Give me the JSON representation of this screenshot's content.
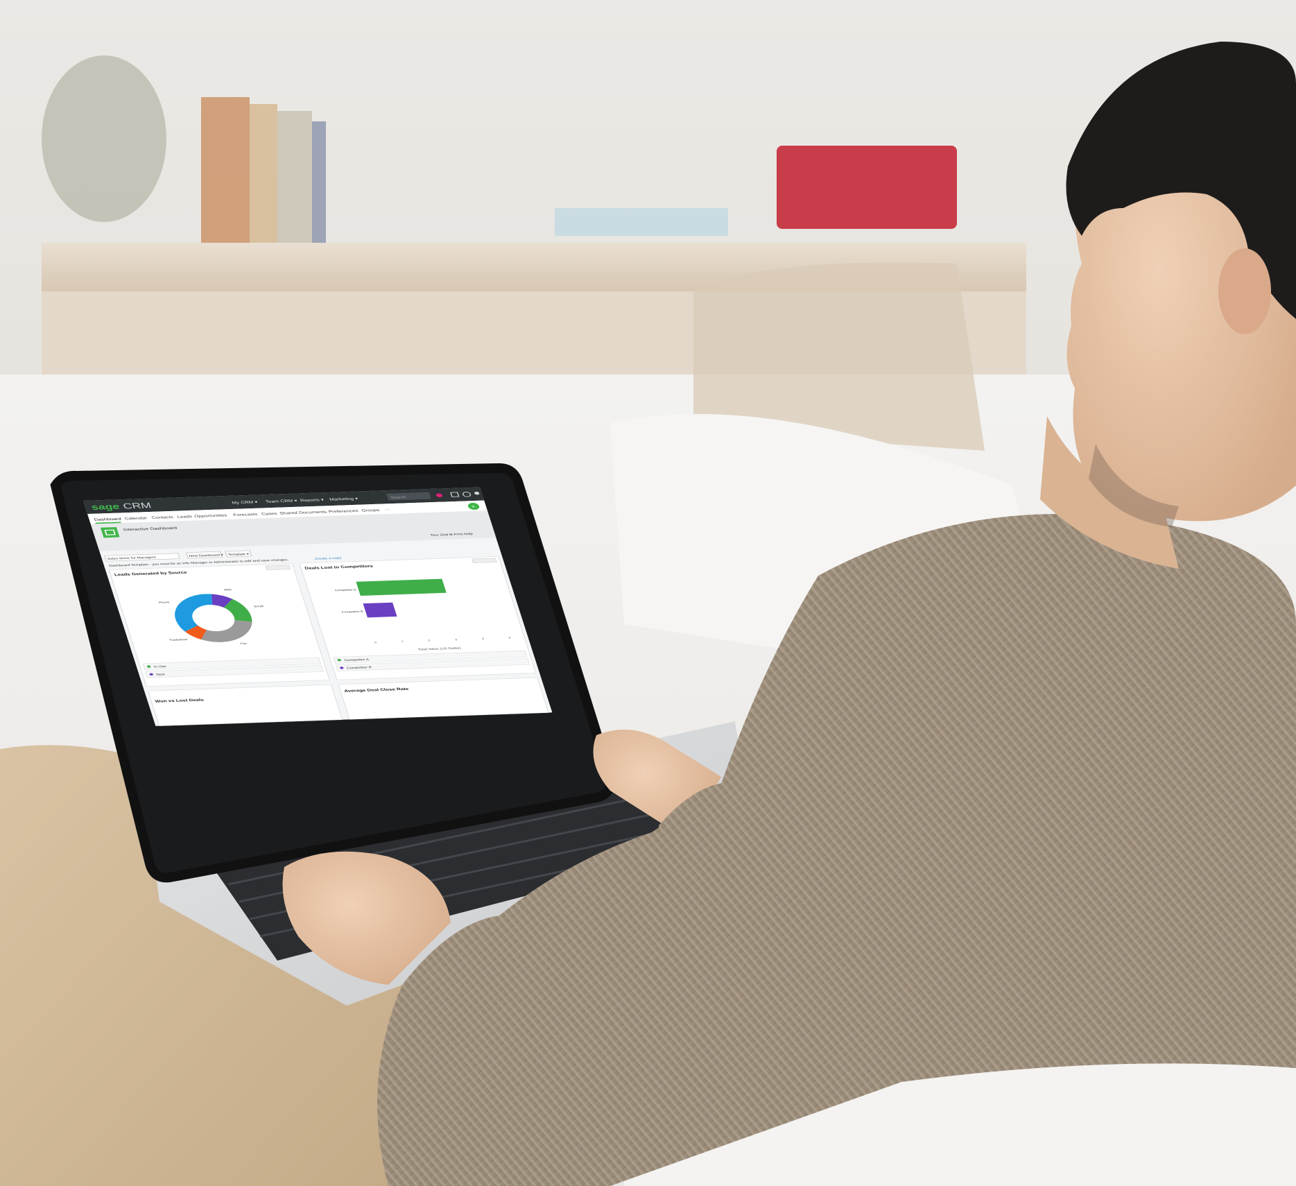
{
  "crm": {
    "logo_brand": "sage",
    "logo_product": "CRM",
    "top_menu": [
      "My CRM ▾",
      "Team CRM ▾",
      "Reports ▾",
      "Marketing ▾"
    ],
    "search_placeholder": "Search",
    "tabs": [
      "Dashboard",
      "Calendar",
      "Contacts",
      "Leads",
      "Opportunities",
      "Forecasts",
      "Cases",
      "Shared Documents",
      "Preferences",
      "Groups",
      "⋯"
    ],
    "page_title": "Interactive Dashboard",
    "top_right_actions": "Tour Grid ⊞  Print  Help",
    "selector_value": "Sales Items for Managers",
    "new_dashboard_button": "New Dashboard ▾",
    "template_button": "Template ▾",
    "notice": "Dashboard Template - you must be an Info Manager or Administrator to edit and save changes.",
    "notice_link": "Create a copy",
    "panels": {
      "leads": "Leads Generated by Source",
      "deals_lost": "Deals Lost to Competitors",
      "won_lost": "Won vs Lost Deals",
      "avg_close": "Average Deal Close Rate"
    },
    "bar_axis_label": "Total Value (US Dollar)",
    "leads_list": [
      "In Use",
      "New"
    ],
    "deals_list": [
      "Competitor A",
      "Competitor B"
    ]
  },
  "chart_data": [
    {
      "type": "pie",
      "title": "Leads Generated by Source",
      "slices": [
        {
          "label": "Web",
          "value": 9,
          "color": "#6a3fc2"
        },
        {
          "label": "Email",
          "value": 17,
          "color": "#3fae49"
        },
        {
          "label": "Fax",
          "value": 30,
          "color": "#9a9a9a"
        },
        {
          "label": "Tradeshow",
          "value": 8,
          "color": "#f05a1a"
        },
        {
          "label": "Phone",
          "value": 36,
          "color": "#1e9be0"
        }
      ]
    },
    {
      "type": "bar",
      "title": "Deals Lost to Competitors",
      "categories": [
        "Competitor A",
        "Competitor B"
      ],
      "values": [
        3.2,
        1.1
      ],
      "colors": [
        "#3fae49",
        "#6a3fc2"
      ],
      "xlim": [
        0,
        5
      ],
      "xticks": [
        "0",
        "1",
        "2",
        "3",
        "4",
        "5"
      ],
      "xlabel": "Total Value (US Dollar)"
    }
  ]
}
